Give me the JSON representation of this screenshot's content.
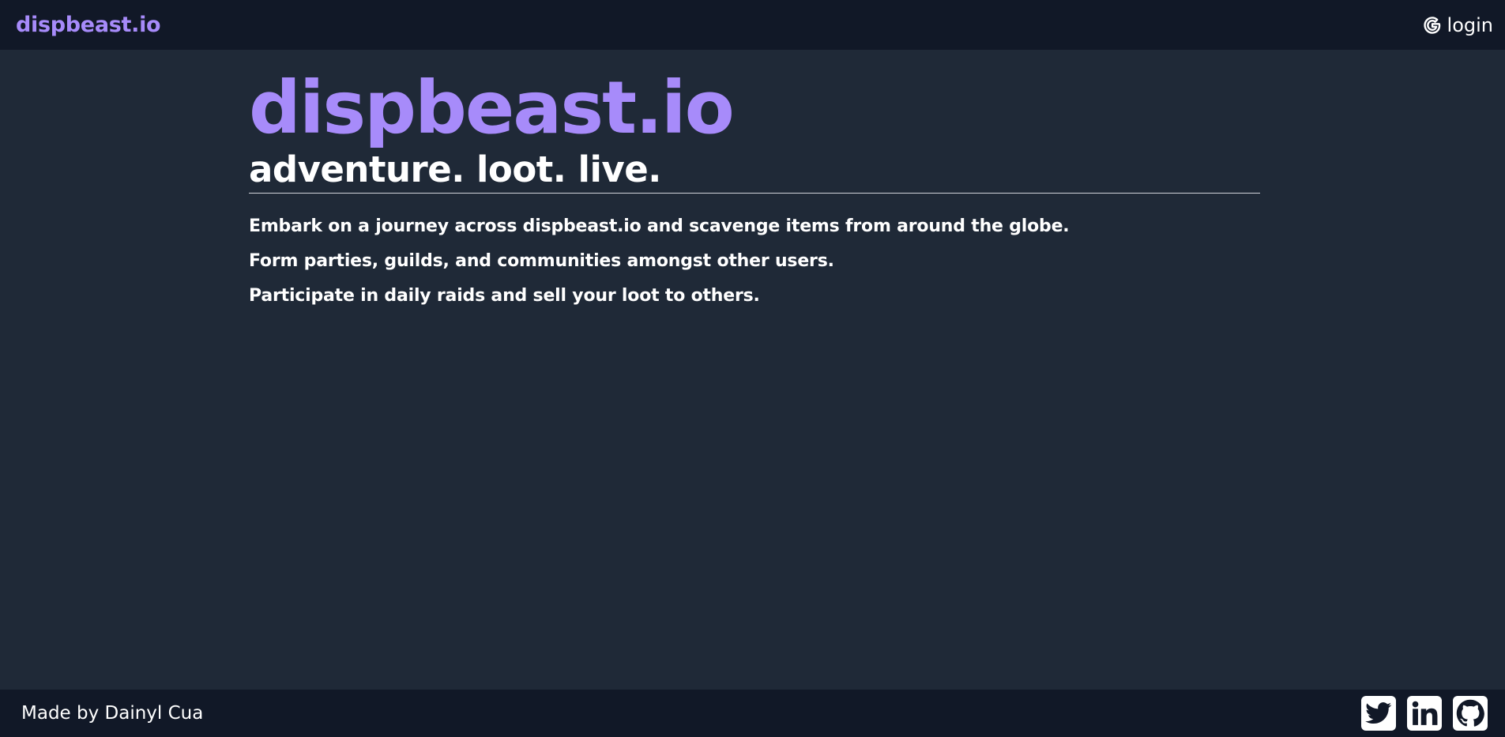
{
  "navbar": {
    "brand": "dispbeast.io",
    "login_label": "login",
    "login_icon": "google-icon"
  },
  "hero": {
    "title": "dispbeast.io",
    "tagline": "adventure. loot. live."
  },
  "description": [
    "Embark on a journey across dispbeast.io and scavenge items from around the globe.",
    "Form parties, guilds, and communities amongst other users.",
    "Participate in daily raids and sell your loot to others."
  ],
  "footer": {
    "credit": "Made by Dainyl Cua",
    "socials": [
      "twitter-icon",
      "linkedin-icon",
      "github-icon"
    ]
  },
  "colors": {
    "background": "#1f2937",
    "bars": "#111827",
    "accent": "#a78bfa",
    "text": "#ffffff"
  }
}
